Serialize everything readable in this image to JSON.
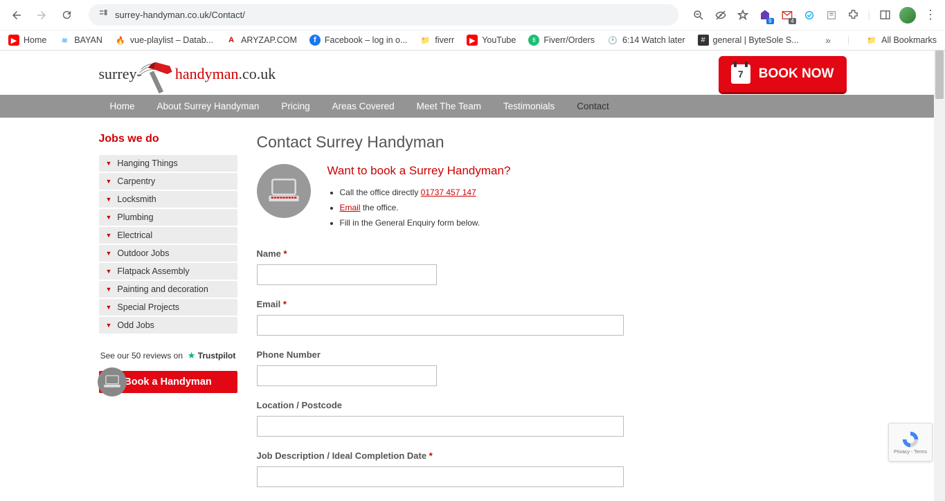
{
  "browser": {
    "url": "surrey-handyman.co.uk/Contact/",
    "bookmarks": [
      {
        "label": "Home",
        "icon": "yt",
        "color": "#f00"
      },
      {
        "label": "BAYAN",
        "icon": "b",
        "color": "#1e88e5"
      },
      {
        "label": "vue-playlist – Datab...",
        "icon": "fire",
        "color": "#ff9800"
      },
      {
        "label": "ARYZAP.COM",
        "icon": "a",
        "color": "#c00"
      },
      {
        "label": "Facebook – log in o...",
        "icon": "fb",
        "color": "#1877f2"
      },
      {
        "label": "fiverr",
        "icon": "folder",
        "color": "#5f6368"
      },
      {
        "label": "YouTube",
        "icon": "yt",
        "color": "#f00"
      },
      {
        "label": "Fiverr/Orders",
        "icon": "f",
        "color": "#1dbf73"
      },
      {
        "label": "6:14 Watch later",
        "icon": "clock",
        "color": "#5f6368"
      },
      {
        "label": "general | ByteSole S...",
        "icon": "hash",
        "color": "#333"
      }
    ],
    "all_bookmarks": "All Bookmarks"
  },
  "header": {
    "logo_part1": "surrey-",
    "logo_part2": "handyman",
    "logo_part3": ".co.uk",
    "book_now": "BOOK NOW",
    "cal_day": "7"
  },
  "nav": [
    "Home",
    "About Surrey Handyman",
    "Pricing",
    "Areas Covered",
    "Meet The Team",
    "Testimonials",
    "Contact"
  ],
  "sidebar": {
    "title": "Jobs we do",
    "items": [
      "Hanging Things",
      "Carpentry",
      "Locksmith",
      "Plumbing",
      "Electrical",
      "Outdoor Jobs",
      "Flatpack Assembly",
      "Painting and decoration",
      "Special Projects",
      "Odd Jobs"
    ],
    "trustpilot_text": "See our 50 reviews on",
    "trustpilot_brand": "Trustpilot",
    "book_button": "Book a Handyman"
  },
  "content": {
    "title": "Contact Surrey Handyman",
    "intro_title": "Want to book a Surrey Handyman?",
    "intro": {
      "line1_pre": "Call the office directly ",
      "phone": "01737 457 147",
      "line2_link": "Email",
      "line2_post": " the office.",
      "line3": "Fill in the General Enquiry form below."
    },
    "form": {
      "name_label": "Name",
      "email_label": "Email",
      "phone_label": "Phone Number",
      "location_label": "Location / Postcode",
      "job_label": "Job Description / Ideal Completion Date"
    }
  },
  "recaptcha": {
    "privacy": "Privacy",
    "terms": "Terms"
  }
}
